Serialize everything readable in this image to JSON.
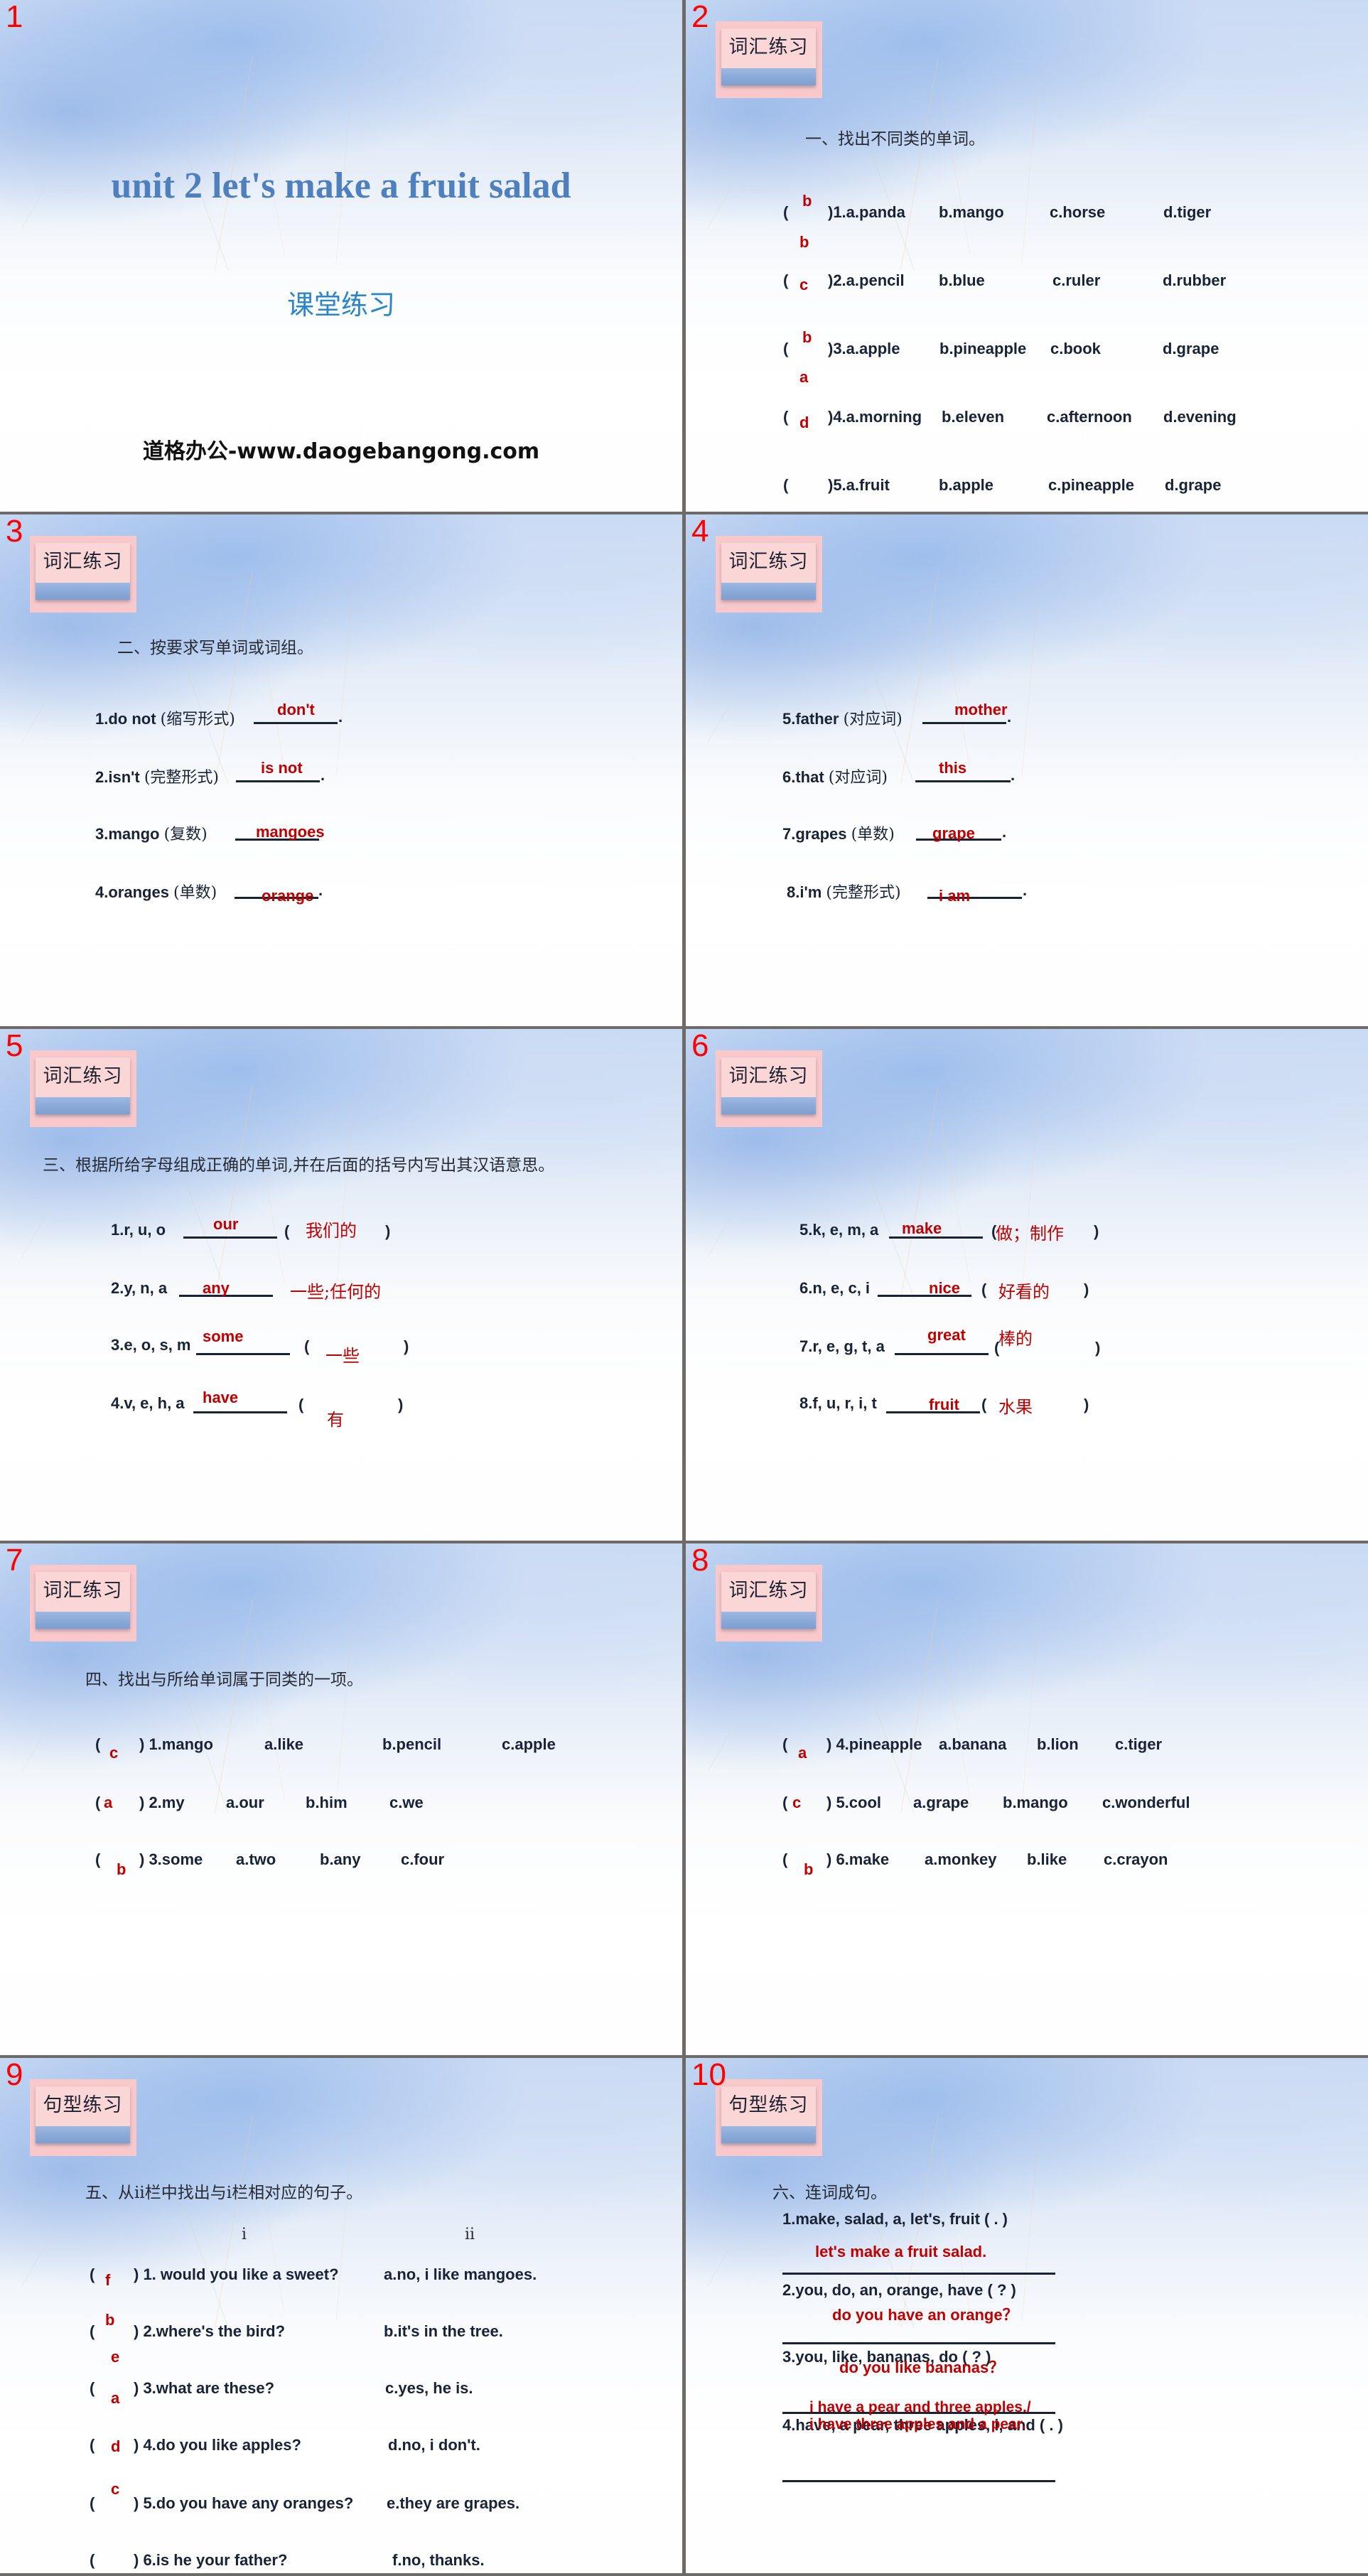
{
  "slides": [
    {
      "number": "1",
      "title": "unit 2 let's make a fruit salad",
      "subtitle": "课堂练习",
      "footer": "道格办公-www.daogebangong.com"
    },
    {
      "number": "2",
      "badge": "词汇练习",
      "heading": "一、找出不同类的单词。",
      "items": [
        {
          "answer": "b",
          "num": ")1.a.panda",
          "options": [
            "b.mango",
            "c.horse",
            "d.tiger"
          ]
        },
        {
          "answer": "b",
          "num": ")2.a.pencil",
          "options": [
            "b.blue",
            "c.ruler",
            "d.rubber"
          ]
        },
        {
          "answer": "c",
          "num": ")3.a.apple",
          "options": [
            "b.pineapple",
            "c.book",
            "d.grape"
          ]
        },
        {
          "answer": "b",
          "num": ")4.a.morning",
          "options": [
            "b.eleven",
            "c.afternoon",
            "d.evening"
          ]
        },
        {
          "answer": "d",
          "num": ")5.a.fruit",
          "options": [
            "b.apple",
            "c.pineapple",
            "d.grape"
          ]
        }
      ],
      "extra_answer": "a",
      "open_paren": "("
    },
    {
      "number": "3",
      "badge": "词汇练习",
      "heading": "二、按要求写单词或词组。",
      "items": [
        {
          "prefix": "1.do not ",
          "hint": "(缩写形式)",
          "answer": "don't",
          "end": "."
        },
        {
          "prefix": "2.isn't ",
          "hint": "(完整形式)",
          "answer": "is not",
          "end": "."
        },
        {
          "prefix": "3.mango ",
          "hint": "(复数)",
          "answer": "mangoes",
          "end": ""
        },
        {
          "prefix": "4.oranges ",
          "hint": "(单数)",
          "answer": "orange",
          "end": "."
        }
      ]
    },
    {
      "number": "4",
      "badge": "词汇练习",
      "items": [
        {
          "prefix": "5.father ",
          "hint": "(对应词)",
          "answer": "mother",
          "end": "."
        },
        {
          "prefix": "6.that ",
          "hint": "(对应词)",
          "answer": "this",
          "end": "."
        },
        {
          "prefix": "7.grapes ",
          "hint": "(单数)",
          "answer": "grape",
          "end": "."
        },
        {
          "prefix": "8.i'm ",
          "hint": "(完整形式)",
          "answer": "i am",
          "end": "."
        }
      ]
    },
    {
      "number": "5",
      "badge": "词汇练习",
      "heading": "三、根据所给字母组成正确的单词,并在后面的括号内写出其汉语意思。",
      "items": [
        {
          "letters": "1.r, u, o",
          "answer": "our",
          "meaning": "我们的"
        },
        {
          "letters": "2.y, n, a",
          "answer": "any",
          "meaning": "一些;任何的"
        },
        {
          "letters": "3.e, o, s, m",
          "answer": "some",
          "meaning": "一些"
        },
        {
          "letters": "4.v, e, h, a",
          "answer": "have",
          "meaning": "有"
        }
      ],
      "open_paren": "(",
      "close_paren": ")"
    },
    {
      "number": "6",
      "badge": "词汇练习",
      "items": [
        {
          "letters": "5.k, e, m, a",
          "answer": "make",
          "meaning": "做；制作"
        },
        {
          "letters": "6.n, e, c, i",
          "answer": "nice",
          "meaning": "好看的"
        },
        {
          "letters": "7.r, e, g, t, a",
          "answer": "great",
          "meaning": "棒的"
        },
        {
          "letters": "8.f, u, r, i, t",
          "answer": "fruit",
          "meaning": "水果"
        }
      ],
      "open_paren": "(",
      "close_paren": ")"
    },
    {
      "number": "7",
      "badge": "词汇练习",
      "heading": "四、找出与所给单词属于同类的一项。",
      "items": [
        {
          "answer": "c",
          "word": ") 1.mango",
          "options": [
            "a.like",
            "b.pencil",
            "c.apple"
          ]
        },
        {
          "answer": "a",
          "word": ") 2.my",
          "options": [
            "a.our",
            "b.him",
            "c.we"
          ]
        },
        {
          "answer": "b",
          "word": ") 3.some",
          "options": [
            "a.two",
            "b.any",
            "c.four"
          ]
        }
      ],
      "open_paren": "("
    },
    {
      "number": "8",
      "badge": "词汇练习",
      "items": [
        {
          "answer": "a",
          "word": ") 4.pineapple",
          "options": [
            "a.banana",
            "b.lion",
            "c.tiger"
          ]
        },
        {
          "answer": "c",
          "word": ") 5.cool",
          "options": [
            "a.grape",
            "b.mango",
            "c.wonderful"
          ]
        },
        {
          "answer": "b",
          "word": ") 6.make",
          "options": [
            "a.monkey",
            "b.like",
            "c.crayon"
          ]
        }
      ],
      "open_paren": "("
    },
    {
      "number": "9",
      "badge": "句型练习",
      "heading": "五、从ⅱ栏中找出与ⅰ栏相对应的句子。",
      "col_i": "i",
      "col_ii": "ii",
      "items": [
        {
          "answer": "f",
          "question": ") 1. would you like a sweet?",
          "response": "a.no, i like mangoes."
        },
        {
          "answer": "b",
          "question": ") 2.where's the bird?",
          "response": "b.it's in the tree."
        },
        {
          "answer": "e",
          "question": ") 3.what are these?",
          "response": "c.yes, he is."
        },
        {
          "answer": "d",
          "question": ") 4.do you like apples?",
          "response": "d.no, i don't."
        },
        {
          "answer": "c",
          "question": ") 5.do you have any oranges?",
          "response": "e.they are grapes."
        },
        {
          "answer": "",
          "question": ") 6.is he your father?",
          "response": "f.no, thanks."
        }
      ],
      "extra_answer": "a",
      "open_paren": "("
    },
    {
      "number": "10",
      "badge": "句型练习",
      "heading": "六、连词成句。",
      "items": [
        {
          "prompt": "1.make, salad, a, let's, fruit ( . )",
          "answer": "let's make a fruit salad."
        },
        {
          "prompt": "2.you, do, an, orange, have ( ? )",
          "answer": "do you have an orange？"
        },
        {
          "prompt": "3.you, like, bananas, do ( ? )",
          "answer": "do you like bananas？"
        },
        {
          "prompt": "4.have, a pear, three apples, i, and ( . )",
          "answer": "i have a pear and three apples./",
          "answer2": "i have three apples and a pear."
        }
      ]
    }
  ],
  "colors": {
    "slide_number": "#ff0000",
    "answer": "#c00000",
    "title": "#4f7fbd",
    "subtitle": "#2a86c8",
    "badge_bg": "#f8c8cb",
    "badge_bar": "#8aa9d8",
    "body_text": "#1a2236",
    "divider": "#6f6a6a"
  }
}
